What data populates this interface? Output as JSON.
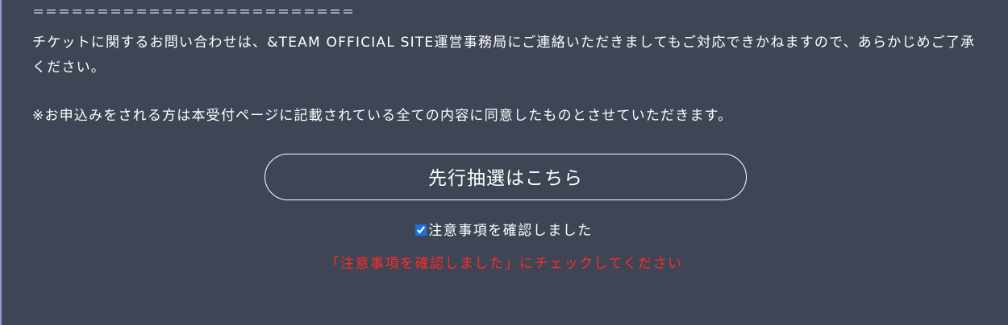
{
  "divider": "＝＝＝＝＝＝＝＝＝＝＝＝＝＝＝＝＝＝＝＝＝＝＝＝＝",
  "notice": {
    "contact_text": "チケットに関するお問い合わせは、&TEAM OFFICIAL SITE運営事務局にご連絡いただきましてもご対応できかねますので、あらかじめご了承ください。",
    "agreement_text": "※お申込みをされる方は本受付ページに記載されている全ての内容に同意したものとさせていただきます。"
  },
  "cta": {
    "label": "先行抽選はこちら"
  },
  "confirm": {
    "label": "注意事項を確認しました",
    "checked": true
  },
  "error": {
    "message": "「注意事項を確認しました」にチェックしてください",
    "color": "#ff2a2a"
  },
  "colors": {
    "background": "#3e4655",
    "text": "#ffffff"
  }
}
